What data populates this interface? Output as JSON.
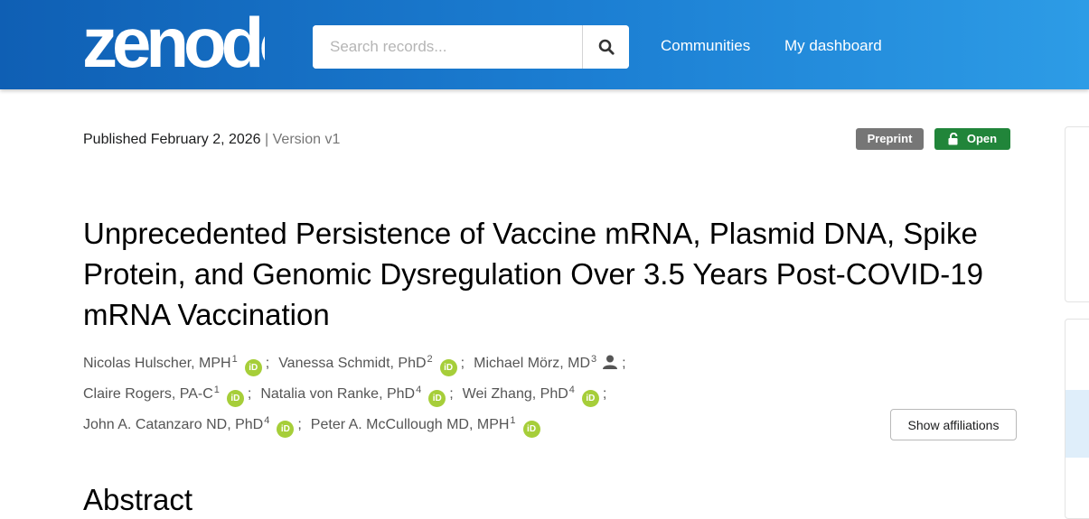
{
  "header": {
    "logo_text": "zenodo",
    "search": {
      "placeholder": "Search records..."
    },
    "nav": [
      {
        "label": "Communities"
      },
      {
        "label": "My dashboard"
      }
    ]
  },
  "record": {
    "published": "Published February 2, 2026",
    "version_separator": " | Version v1",
    "badges": {
      "type": "Preprint",
      "access": "Open"
    },
    "title": "Unprecedented Persistence of Vaccine mRNA, Plasmid DNA, Spike Protein, and Genomic Dysregulation Over 3.5 Years Post-COVID-19 mRNA Vaccination",
    "author_lines": [
      [
        {
          "name": "Nicolas Hulscher, MPH",
          "aff": "1",
          "orcid": true
        },
        {
          "name": "Vanessa Schmidt, PhD",
          "aff": "2",
          "orcid": true
        },
        {
          "name": "Michael Mörz, MD",
          "aff": "3",
          "orcid": false
        }
      ],
      [
        {
          "name": "Claire Rogers, PA-C",
          "aff": "1",
          "orcid": true
        },
        {
          "name": "Natalia von Ranke, PhD",
          "aff": "4",
          "orcid": true
        },
        {
          "name": "Wei Zhang, PhD",
          "aff": "4",
          "orcid": true
        }
      ],
      [
        {
          "name": "John A. Catanzaro ND, PhD",
          "aff": "4",
          "orcid": true
        },
        {
          "name": "Peter A. McCullough MD, MPH",
          "aff": "1",
          "orcid": true
        }
      ]
    ],
    "orcid_glyph": "iD",
    "show_affiliations_label": "Show affiliations",
    "abstract_heading": "Abstract"
  },
  "icons": {
    "search": "search-icon",
    "lock": "unlock-icon",
    "person": "person-icon",
    "orcid": "orcid-icon"
  },
  "colors": {
    "header_start": "#0f5fb4",
    "header_end": "#2d9ce6",
    "open_badge": "#21853a",
    "preprint_badge": "#767676",
    "orcid": "#a6ce39"
  }
}
